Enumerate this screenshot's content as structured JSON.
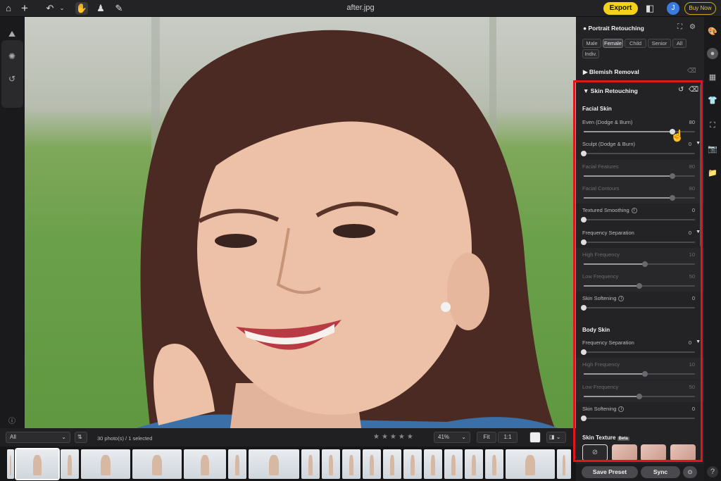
{
  "app": {
    "doc_title": "after.jpg",
    "export_label": "Export",
    "avatar_initial": "J",
    "buy_label": "Buy Now"
  },
  "icons": {
    "home": "home-icon",
    "add": "plus-icon",
    "undo": "undo-icon",
    "hand": "hand-icon",
    "stamp": "stamp-icon",
    "brush": "brush-icon",
    "compare": "compare-icon"
  },
  "colors": {
    "accent": "#f5d21a",
    "highlight": "#e0161e",
    "panel": "#232325"
  },
  "panel": {
    "portrait": {
      "title": "Portrait Retouching",
      "chips": [
        "Male",
        "Female",
        "Child",
        "Senior",
        "All",
        "Indiv."
      ],
      "selected_chip": "Female"
    },
    "blemish": {
      "title": "Blemish Removal"
    },
    "skin": {
      "title": "Skin Retouching",
      "facial_title": "Facial Skin",
      "facial_sliders": [
        {
          "label": "Even (Dodge & Burn)",
          "value": "80",
          "level": 0.8,
          "dim": false,
          "alt": false
        },
        {
          "label": "Sculpt (Dodge & Burn)",
          "value": "0",
          "level": 0.0,
          "dim": false,
          "alt": false,
          "caret": true
        },
        {
          "label": "Facial Features",
          "value": "80",
          "level": 0.8,
          "dim": true,
          "alt": true
        },
        {
          "label": "Facial Contours",
          "value": "80",
          "level": 0.8,
          "dim": true,
          "alt": true
        },
        {
          "label": "Textured Smoothing",
          "value": "0",
          "level": 0.0,
          "dim": false,
          "alt": false,
          "info": true
        },
        {
          "label": "Frequency Separation",
          "value": "0",
          "level": 0.0,
          "dim": false,
          "alt": false,
          "caret": true
        },
        {
          "label": "High Frequency",
          "value": "10",
          "level": 0.55,
          "dim": true,
          "alt": true
        },
        {
          "label": "Low Frequency",
          "value": "50",
          "level": 0.5,
          "dim": true,
          "alt": true
        },
        {
          "label": "Skin Softening",
          "value": "0",
          "level": 0.0,
          "dim": false,
          "alt": false,
          "info": true
        }
      ],
      "body_title": "Body Skin",
      "body_sliders": [
        {
          "label": "Frequency Separation",
          "value": "0",
          "level": 0.0,
          "dim": false,
          "alt": false,
          "caret": true
        },
        {
          "label": "High Frequency",
          "value": "10",
          "level": 0.55,
          "dim": true,
          "alt": true
        },
        {
          "label": "Low Frequency",
          "value": "50",
          "level": 0.5,
          "dim": true,
          "alt": true
        },
        {
          "label": "Skin Softening",
          "value": "0",
          "level": 0.0,
          "dim": false,
          "alt": false,
          "info": true
        }
      ],
      "texture_title": "Skin Texture",
      "texture_badge": "Beta"
    },
    "footer": {
      "save_preset": "Save Preset",
      "sync": "Sync"
    }
  },
  "filmstrip": {
    "filter": "All",
    "count_text": "30 photo(s) / 1 selected",
    "zoom": "41%",
    "fit": "Fit",
    "one_to_one": "1:1"
  }
}
